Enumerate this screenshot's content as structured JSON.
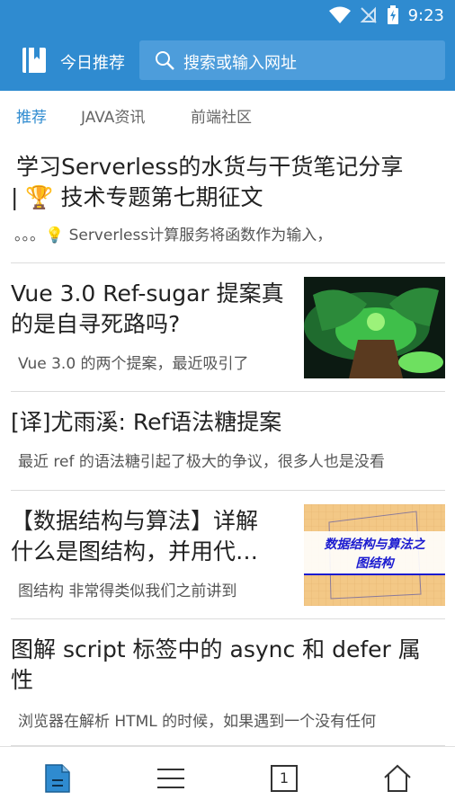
{
  "status_bar": {
    "time": "9:23"
  },
  "app_bar": {
    "title": "今日推荐",
    "search_placeholder": "搜索或输入网址"
  },
  "tabs": [
    {
      "label": "推荐",
      "active": true
    },
    {
      "label": "JAVA资讯",
      "active": false
    },
    {
      "label": "前端社区",
      "active": false
    }
  ],
  "articles": [
    {
      "title_line1": "学习Serverless的水货与干货笔记分享",
      "title_line2": "| 🏆 技术专题第七期征文",
      "desc": "。。。💡 Serverless计算服务将函数作为输入，"
    },
    {
      "title_line1": "Vue 3.0 Ref-sugar 提案真",
      "title_line2": "的是自寻死路吗?",
      "desc": "Vue 3.0 的两个提案，最近吸引了"
    },
    {
      "title_line1": "[译]尤雨溪: Ref语法糖提案",
      "desc": "最近 ref 的语法糖引起了极大的争议，很多人也是没看"
    },
    {
      "title_line1": "【数据结构与算法】详解",
      "title_line2": "什么是图结构，并用代…",
      "desc": "图结构 非常得类似我们之前讲到",
      "thumb_text_line1": "数据结构与算法之",
      "thumb_text_line2": "图结构"
    },
    {
      "title_line1": "图解 script 标签中的 async 和 defer 属",
      "title_line2": "性",
      "desc": "浏览器在解析 HTML 的时候，如果遇到一个没有任何"
    }
  ],
  "bottom_nav": {
    "tabs_count": "1"
  },
  "colors": {
    "primary": "#2f8bd0",
    "search_bg": "#4d9ddb"
  }
}
